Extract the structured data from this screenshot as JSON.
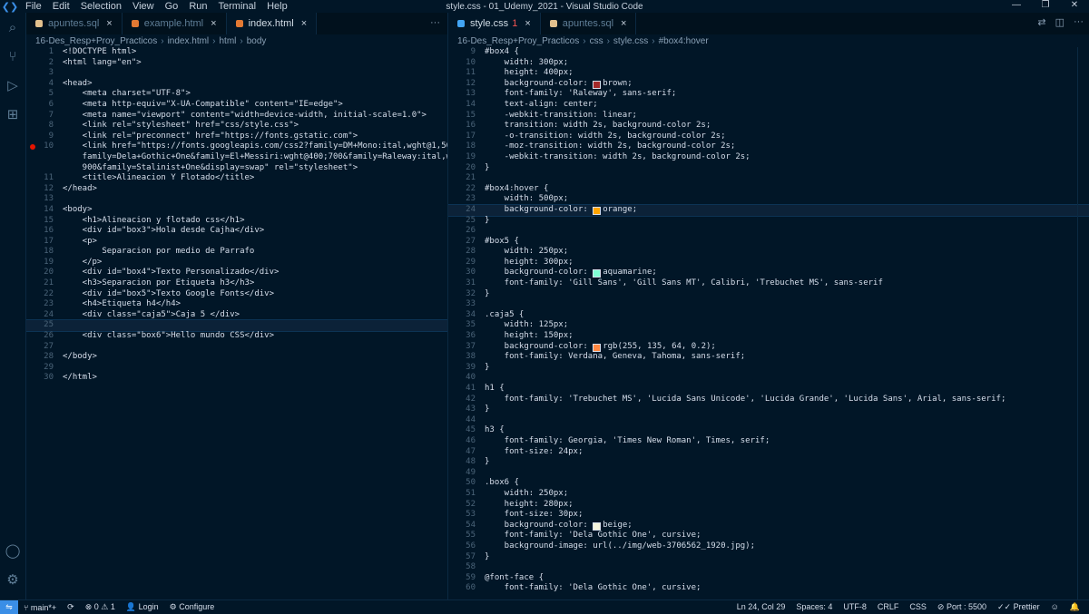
{
  "window": {
    "title": "style.css - 01_Udemy_2021 - Visual Studio Code",
    "menu": [
      "File",
      "Edit",
      "Selection",
      "View",
      "Go",
      "Run",
      "Terminal",
      "Help"
    ]
  },
  "left": {
    "tabs": [
      {
        "label": "apuntes.sql",
        "color": "#e2c08d",
        "active": false
      },
      {
        "label": "example.html",
        "color": "#e37933",
        "active": false
      },
      {
        "label": "index.html",
        "color": "#e37933",
        "active": true
      }
    ],
    "breadcrumb": [
      "16-Des_Resp+Proy_Practicos",
      "index.html",
      "html",
      "body"
    ],
    "lines": [
      {
        "n": "1",
        "text": "<!DOCTYPE html>"
      },
      {
        "n": "2",
        "text": "<html lang=\"en\">"
      },
      {
        "n": "3",
        "text": ""
      },
      {
        "n": "4",
        "text": "<head>"
      },
      {
        "n": "5",
        "text": "    <meta charset=\"UTF-8\">"
      },
      {
        "n": "6",
        "text": "    <meta http-equiv=\"X-UA-Compatible\" content=\"IE=edge\">"
      },
      {
        "n": "7",
        "text": "    <meta name=\"viewport\" content=\"width=device-width, initial-scale=1.0\">"
      },
      {
        "n": "8",
        "text": "    <link rel=\"stylesheet\" href=\"css/style.css\">"
      },
      {
        "n": "9",
        "text": "    <link rel=\"preconnect\" href=\"https://fonts.gstatic.com\">"
      },
      {
        "n": "10",
        "text": "    <link href=\"https://fonts.googleapis.com/css2?family=DM+Mono:ital,wght@1,500&",
        "bp": true
      },
      {
        "n": "",
        "text": "    family=Dela+Gothic+One&family=El+Messiri:wght@400;700&family=Raleway:ital,wght@1,"
      },
      {
        "n": "",
        "text": "    900&family=Stalinist+One&display=swap\" rel=\"stylesheet\">"
      },
      {
        "n": "11",
        "text": "    <title>Alineacion Y Flotado</title>"
      },
      {
        "n": "12",
        "text": "</head>"
      },
      {
        "n": "13",
        "text": ""
      },
      {
        "n": "14",
        "text": "<body>"
      },
      {
        "n": "15",
        "text": "    <h1>Alineacion y flotado css</h1>"
      },
      {
        "n": "16",
        "text": "    <div id=\"box3\">Hola desde Cajha</div>"
      },
      {
        "n": "17",
        "text": "    <p>"
      },
      {
        "n": "18",
        "text": "        Separacion por medio de Parrafo"
      },
      {
        "n": "19",
        "text": "    </p>"
      },
      {
        "n": "20",
        "text": "    <div id=\"box4\">Texto Personalizado</div>"
      },
      {
        "n": "21",
        "text": "    <h3>Separacion por Etiqueta h3</h3>"
      },
      {
        "n": "22",
        "text": "    <div id=\"box5\">Texto Google Fonts</div>"
      },
      {
        "n": "23",
        "text": "    <h4>Etiqueta h4</h4>"
      },
      {
        "n": "24",
        "text": "    <div class=\"caja5\">Caja 5 </div>"
      },
      {
        "n": "25",
        "text": "",
        "current": true
      },
      {
        "n": "26",
        "text": "    <div class=\"box6\">Hello mundo CSS</div>"
      },
      {
        "n": "27",
        "text": ""
      },
      {
        "n": "28",
        "text": "</body>"
      },
      {
        "n": "29",
        "text": ""
      },
      {
        "n": "30",
        "text": "</html>"
      }
    ]
  },
  "right": {
    "tabs": [
      {
        "label": "style.css",
        "color": "#42a5f5",
        "active": true,
        "badge": "1"
      },
      {
        "label": "apuntes.sql",
        "color": "#e2c08d",
        "active": false
      }
    ],
    "breadcrumb": [
      "16-Des_Resp+Proy_Practicos",
      "css",
      "style.css",
      "#box4:hover"
    ],
    "lines": [
      {
        "n": "9",
        "text": "#box4 {"
      },
      {
        "n": "10",
        "text": "    width: 300px;"
      },
      {
        "n": "11",
        "text": "    height: 400px;"
      },
      {
        "n": "12",
        "text": "    background-color: ",
        "swatch": "#a52a2a",
        "after": "brown;"
      },
      {
        "n": "13",
        "text": "    font-family: 'Raleway', sans-serif;"
      },
      {
        "n": "14",
        "text": "    text-align: center;"
      },
      {
        "n": "15",
        "text": "    -webkit-transition: linear;"
      },
      {
        "n": "16",
        "text": "    transition: width 2s, background-color 2s;"
      },
      {
        "n": "17",
        "text": "    -o-transition: width 2s, background-color 2s;"
      },
      {
        "n": "18",
        "text": "    -moz-transition: width 2s, background-color 2s;"
      },
      {
        "n": "19",
        "text": "    -webkit-transition: width 2s, background-color 2s;"
      },
      {
        "n": "20",
        "text": "}"
      },
      {
        "n": "21",
        "text": ""
      },
      {
        "n": "22",
        "text": "#box4:hover {"
      },
      {
        "n": "23",
        "text": "    width: 500px;"
      },
      {
        "n": "24",
        "text": "    background-color: ",
        "swatch": "#ffa500",
        "after": "orange;",
        "current": true
      },
      {
        "n": "25",
        "text": "}"
      },
      {
        "n": "26",
        "text": ""
      },
      {
        "n": "27",
        "text": "#box5 {"
      },
      {
        "n": "28",
        "text": "    width: 250px;"
      },
      {
        "n": "29",
        "text": "    height: 300px;"
      },
      {
        "n": "30",
        "text": "    background-color: ",
        "swatch": "#7fffd4",
        "after": "aquamarine;"
      },
      {
        "n": "31",
        "text": "    font-family: 'Gill Sans', 'Gill Sans MT', Calibri, 'Trebuchet MS', sans-serif"
      },
      {
        "n": "32",
        "text": "}"
      },
      {
        "n": "33",
        "text": ""
      },
      {
        "n": "34",
        "text": ".caja5 {"
      },
      {
        "n": "35",
        "text": "    width: 125px;"
      },
      {
        "n": "36",
        "text": "    height: 150px;"
      },
      {
        "n": "37",
        "text": "    background-color: ",
        "swatch": "#ff8740",
        "after": "rgb(255, 135, 64, 0.2);"
      },
      {
        "n": "38",
        "text": "    font-family: Verdana, Geneva, Tahoma, sans-serif;"
      },
      {
        "n": "39",
        "text": "}"
      },
      {
        "n": "40",
        "text": ""
      },
      {
        "n": "41",
        "text": "h1 {"
      },
      {
        "n": "42",
        "text": "    font-family: 'Trebuchet MS', 'Lucida Sans Unicode', 'Lucida Grande', 'Lucida Sans', Arial, sans-serif;"
      },
      {
        "n": "43",
        "text": "}"
      },
      {
        "n": "44",
        "text": ""
      },
      {
        "n": "45",
        "text": "h3 {"
      },
      {
        "n": "46",
        "text": "    font-family: Georgia, 'Times New Roman', Times, serif;"
      },
      {
        "n": "47",
        "text": "    font-size: 24px;"
      },
      {
        "n": "48",
        "text": "}"
      },
      {
        "n": "49",
        "text": ""
      },
      {
        "n": "50",
        "text": ".box6 {"
      },
      {
        "n": "51",
        "text": "    width: 250px;"
      },
      {
        "n": "52",
        "text": "    height: 280px;"
      },
      {
        "n": "53",
        "text": "    font-size: 30px;"
      },
      {
        "n": "54",
        "text": "    background-color: ",
        "swatch": "#f5f5dc",
        "after": "beige;"
      },
      {
        "n": "55",
        "text": "    font-family: 'Dela Gothic One', cursive;"
      },
      {
        "n": "56",
        "text": "    background-image: url(../img/web-3706562_1920.jpg);"
      },
      {
        "n": "57",
        "text": "}"
      },
      {
        "n": "58",
        "text": ""
      },
      {
        "n": "59",
        "text": "@font-face {"
      },
      {
        "n": "60",
        "text": "    font-family: 'Dela Gothic One', cursive;"
      }
    ]
  },
  "status": {
    "branch": "main*+",
    "problems": "0",
    "warnings": "1",
    "login": "Login",
    "configure": "Configure",
    "position": "Ln 24, Col 29",
    "spaces": "Spaces: 4",
    "encoding": "UTF-8",
    "eol": "CRLF",
    "language": "CSS",
    "port": "Port : 5500",
    "prettier": "Prettier"
  },
  "colors": {
    "accent": "#3a8ee6",
    "background": "#011627",
    "breakpoint": "#e51400"
  }
}
